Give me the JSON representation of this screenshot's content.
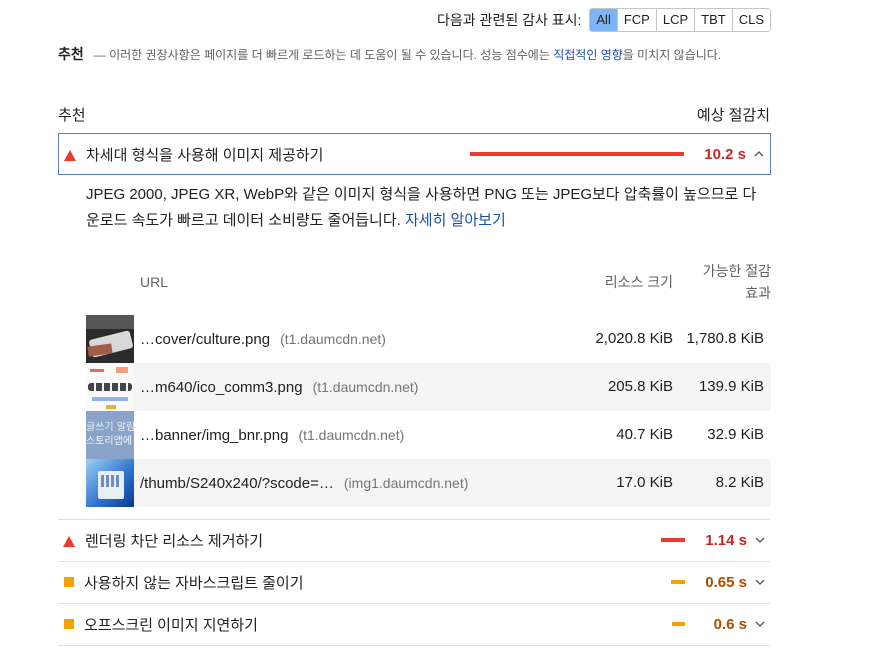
{
  "filter": {
    "label": "다음과 관련된 감사 표시:",
    "chips": [
      "All",
      "FCP",
      "LCP",
      "TBT",
      "CLS"
    ],
    "active": "All"
  },
  "intro": {
    "heading": "추천",
    "text_before": "— 이러한 권장사항은 페이지를 더 빠르게 로드하는 데 도움이 될 수 있습니다. 성능 점수에는 ",
    "link": "직접적인 영향",
    "text_after": "을 미치지 않습니다."
  },
  "table_head": {
    "left": "추천",
    "right": "예상 절감치"
  },
  "open_audit": {
    "title": "차세대 형식을 사용해 이미지 제공하기",
    "value": "10.2 s",
    "bar_fraction": 1.0,
    "description": "JPEG 2000, JPEG XR, WebP와 같은 이미지 형식을 사용하면 PNG 또는 JPEG보다 압축률이 높으므로 다운로드 속도가 빠르고 데이터 소비량도 줄어듭니다. ",
    "learn_more": "자세히 알아보기",
    "columns": {
      "url": "URL",
      "size": "리소스 크기",
      "savings_line1": "가능한 절감",
      "savings_line2": "효과"
    },
    "rows": [
      {
        "url": "…cover/culture.png",
        "host": "(t1.daumcdn.net)",
        "size": "2,020.8 KiB",
        "savings": "1,780.8 KiB",
        "thumb": "photo"
      },
      {
        "url": "…m640/ico_comm3.png",
        "host": "(t1.daumcdn.net)",
        "size": "205.8 KiB",
        "savings": "139.9 KiB",
        "thumb": "icons"
      },
      {
        "url": "…banner/img_bnr.png",
        "host": "(t1.daumcdn.net)",
        "size": "40.7 KiB",
        "savings": "32.9 KiB",
        "thumb": "banner",
        "thumb_text": "글쓰기 알림\n스토리앱에"
      },
      {
        "url": "/thumb/S240x240/?scode=…",
        "host": "(img1.daumcdn.net)",
        "size": "17.0 KiB",
        "savings": "8.2 KiB",
        "thumb": "windows"
      }
    ]
  },
  "audits": [
    {
      "title": "렌더링 차단 리소스 제거하기",
      "value": "1.14 s",
      "status": "fail",
      "bar_fraction": 0.11
    },
    {
      "title": "사용하지 않는 자바스크립트 줄이기",
      "value": "0.65 s",
      "status": "average",
      "bar_fraction": 0.064
    },
    {
      "title": "오프스크린 이미지 지연하기",
      "value": "0.6 s",
      "status": "average",
      "bar_fraction": 0.059
    }
  ],
  "colors": {
    "fail": "#eb3b2f",
    "average": "#f5a200",
    "link": "#1a4fa8",
    "active_chip": "#7eb5f4"
  }
}
